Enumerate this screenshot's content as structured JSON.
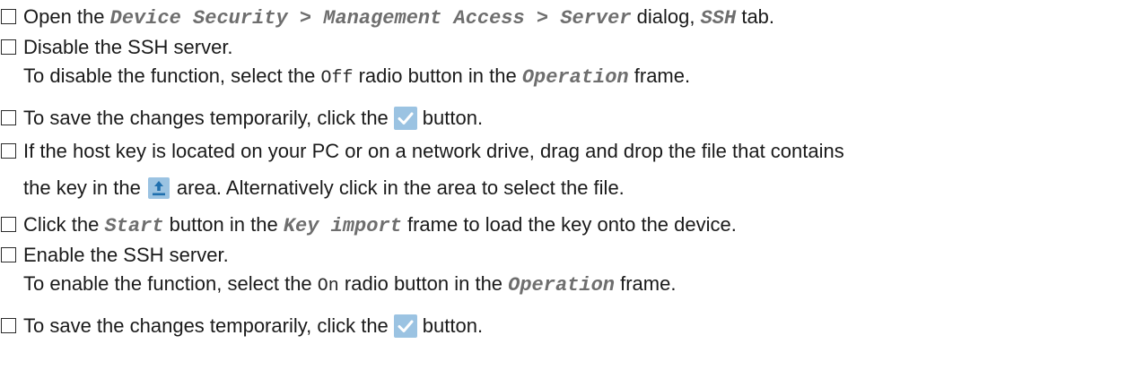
{
  "steps": [
    {
      "a": "Open the ",
      "path": "Device Security > Management Access > Server",
      "b": " dialog, ",
      "tab": "SSH",
      "c": " tab."
    },
    {
      "line1": "Disable the SSH server.",
      "l2a": "To disable the function, select the ",
      "radio": "Off",
      "l2b": " radio button in the ",
      "frame": "Operation",
      "l2c": " frame."
    },
    {
      "a": "To save the changes temporarily, click the",
      "b": "button.",
      "icon": "checkmark-icon"
    },
    {
      "line1": "If the host key is located on your PC or on a network drive, drag and drop the file that contains",
      "l2a": "the key in the",
      "l2b": "area. Alternatively click in the area to select the file.",
      "icon": "upload-icon"
    },
    {
      "a": "Click the ",
      "button": "Start",
      "b": " button in the ",
      "frame": "Key import",
      "c": " frame to load the key onto the device."
    },
    {
      "line1": "Enable the SSH server.",
      "l2a": "To enable the function, select the ",
      "radio": "On",
      "l2b": " radio button in the ",
      "frame": "Operation",
      "l2c": " frame."
    },
    {
      "a": "To save the changes temporarily, click the",
      "b": "button.",
      "icon": "checkmark-icon"
    }
  ],
  "colors": {
    "gui_text": "#6e6e6e",
    "icon_bg": "#9bc3e2",
    "checkmark": "#ffffff",
    "upload_arrow": "#1f6fae"
  }
}
